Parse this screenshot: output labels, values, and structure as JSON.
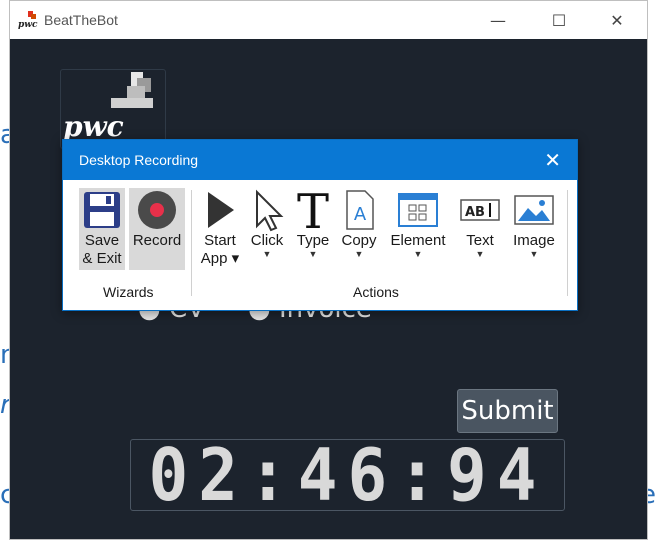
{
  "window": {
    "title": "BeatTheBot",
    "minimize": "—",
    "maximize": "☐",
    "close": "✕"
  },
  "background": {
    "pwc_logo_text": "pwc",
    "radio_cv": "CV",
    "radio_invoice": "Invoice",
    "submit_label": "Submit",
    "clock": "02:46:94"
  },
  "popup": {
    "title": "Desktop Recording",
    "close": "✕",
    "wizards": {
      "group_label": "Wizards",
      "save_exit_line1": "Save",
      "save_exit_line2": "& Exit",
      "record_label": "Record"
    },
    "actions": {
      "group_label": "Actions",
      "start_app_line1": "Start",
      "start_app_line2": "App",
      "click_label": "Click",
      "type_label": "Type",
      "copy_label": "Copy",
      "element_label": "Element",
      "text_label": "Text",
      "image_label": "Image"
    }
  },
  "colors": {
    "accent": "#0a78d4",
    "dark_bg": "#1c232d",
    "record_dot": "#e8304a"
  }
}
